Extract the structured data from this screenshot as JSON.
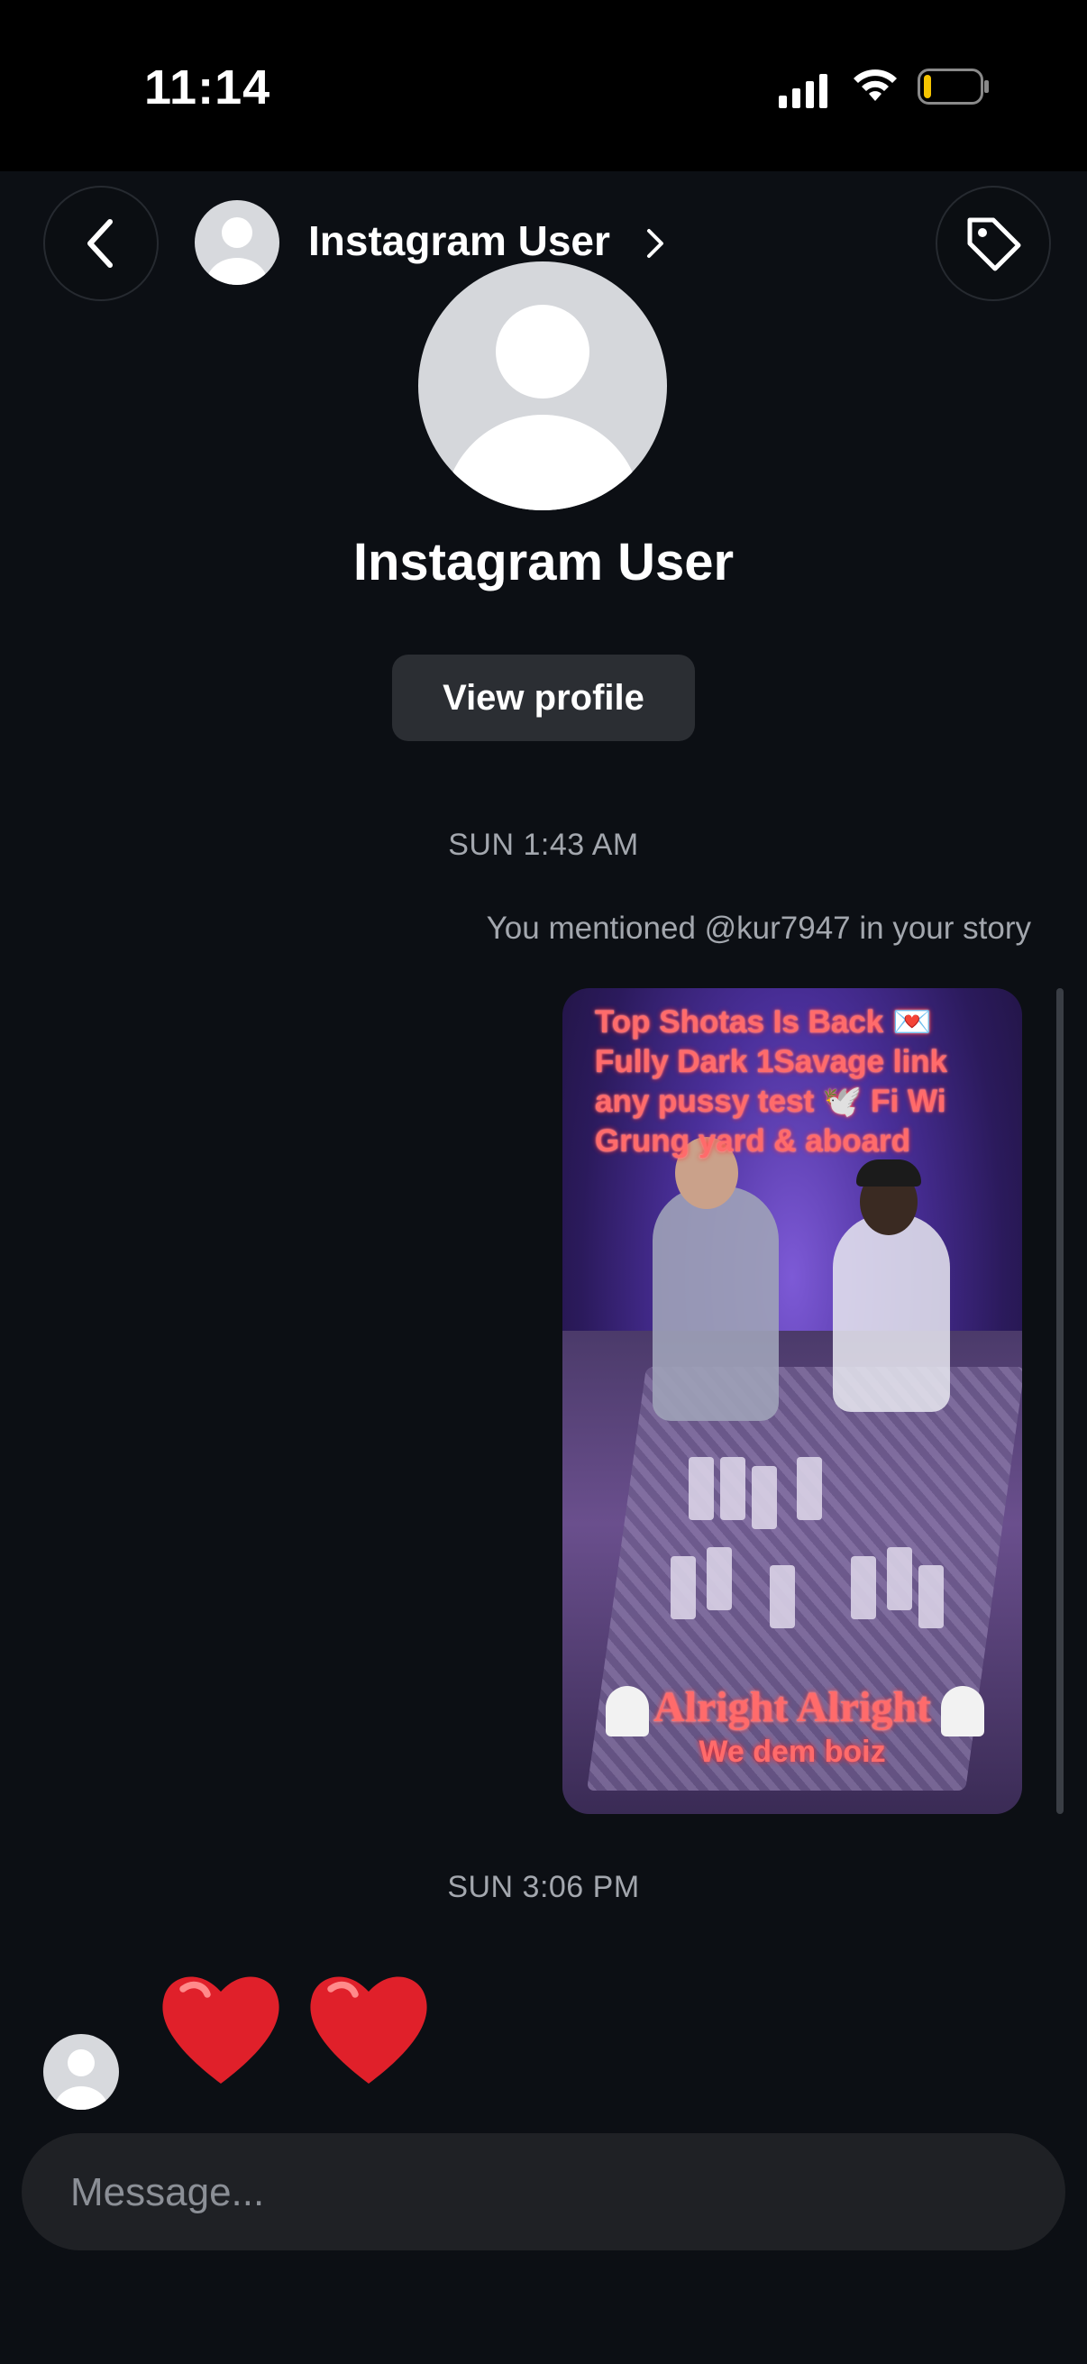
{
  "status_bar": {
    "time": "11:14",
    "battery_level_percent": 10
  },
  "header": {
    "username": "Instagram User",
    "icons": [
      "back-arrow-icon",
      "chevron-right-icon",
      "tag-icon"
    ]
  },
  "profile": {
    "name": "Instagram User",
    "view_profile_label": "View profile"
  },
  "conversation": {
    "timestamp_1": "SUN 1:43 AM",
    "story_mention": "You mentioned @kur7947 in your story",
    "story_caption_top": "Top Shotas Is Back 💌 Fully Dark 1Savage link any pussy test 🕊️ Fi Wi Grung yard & aboard",
    "story_caption_bottom_1": "Alright Alright",
    "story_caption_bottom_2": "We dem boiz",
    "timestamp_2": "SUN 3:06 PM",
    "received_message": "❤️❤️"
  },
  "composer": {
    "placeholder": "Message..."
  },
  "colors": {
    "background": "#0c0f14",
    "button": "#2b2e33",
    "composer": "#1f2125",
    "muted_text": "#a3a7ae",
    "heart": "#e0202a"
  }
}
